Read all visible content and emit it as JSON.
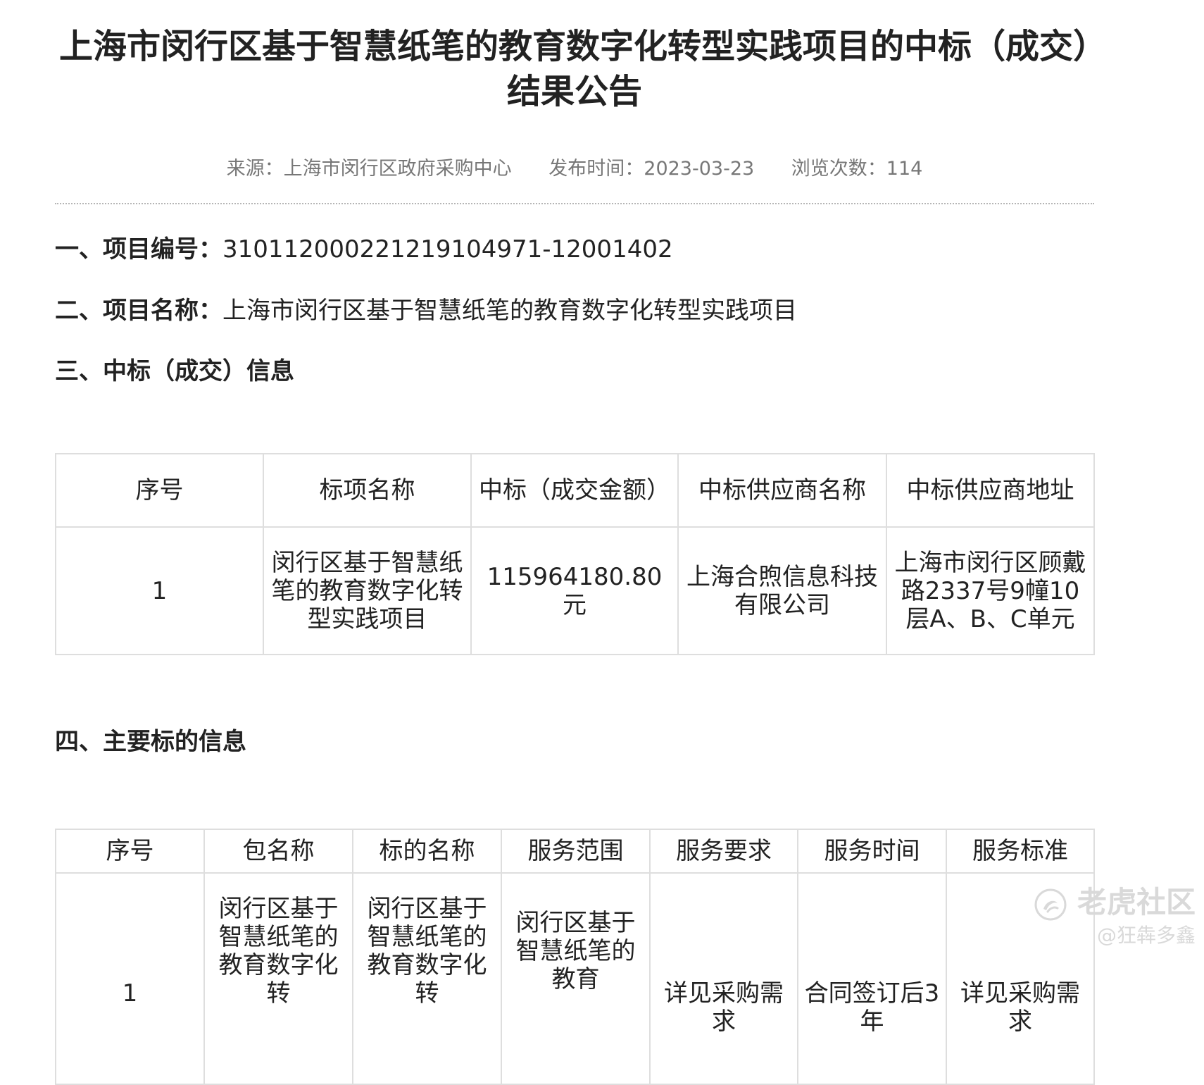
{
  "title": "上海市闵行区基于智慧纸笔的教育数字化转型实践项目的中标（成交）结果公告",
  "meta": {
    "source": "来源：上海市闵行区政府采购中心",
    "publish_time": "发布时间：2023-03-23",
    "views": "浏览次数：114"
  },
  "section1": {
    "label": "一、项目编号：",
    "value": "310112000221219104971-12001402"
  },
  "section2": {
    "label": "二、项目名称：",
    "value": "上海市闵行区基于智慧纸笔的教育数字化转型实践项目"
  },
  "section3": {
    "label": "三、中标（成交）信息"
  },
  "award_table": {
    "headers": [
      "序号",
      "标项名称",
      "中标（成交金额）",
      "中标供应商名称",
      "中标供应商地址"
    ],
    "rows": [
      [
        "1",
        "闵行区基于智慧纸笔的教育数字化转型实践项目",
        "115964180.80元",
        "上海合煦信息科技有限公司",
        "上海市闵行区顾戴路2337号9幢10层A、B、C单元"
      ]
    ]
  },
  "section4": {
    "label": "四、主要标的信息"
  },
  "items_table": {
    "headers": [
      "序号",
      "包名称",
      "标的名称",
      "服务范围",
      "服务要求",
      "服务时间",
      "服务标准"
    ],
    "rows": [
      [
        "1",
        "闵行区基于智慧纸笔的教育数字化转",
        "闵行区基于智慧纸笔的教育数字化转",
        "闵行区基于智慧纸笔的教育",
        "详见采购需求",
        "合同签订后3年",
        "详见采购需求"
      ]
    ]
  },
  "watermark": {
    "brand": "老虎社区",
    "user": "@狂犇多鑫",
    "logo_icon": "tiger-community-logo-icon"
  }
}
